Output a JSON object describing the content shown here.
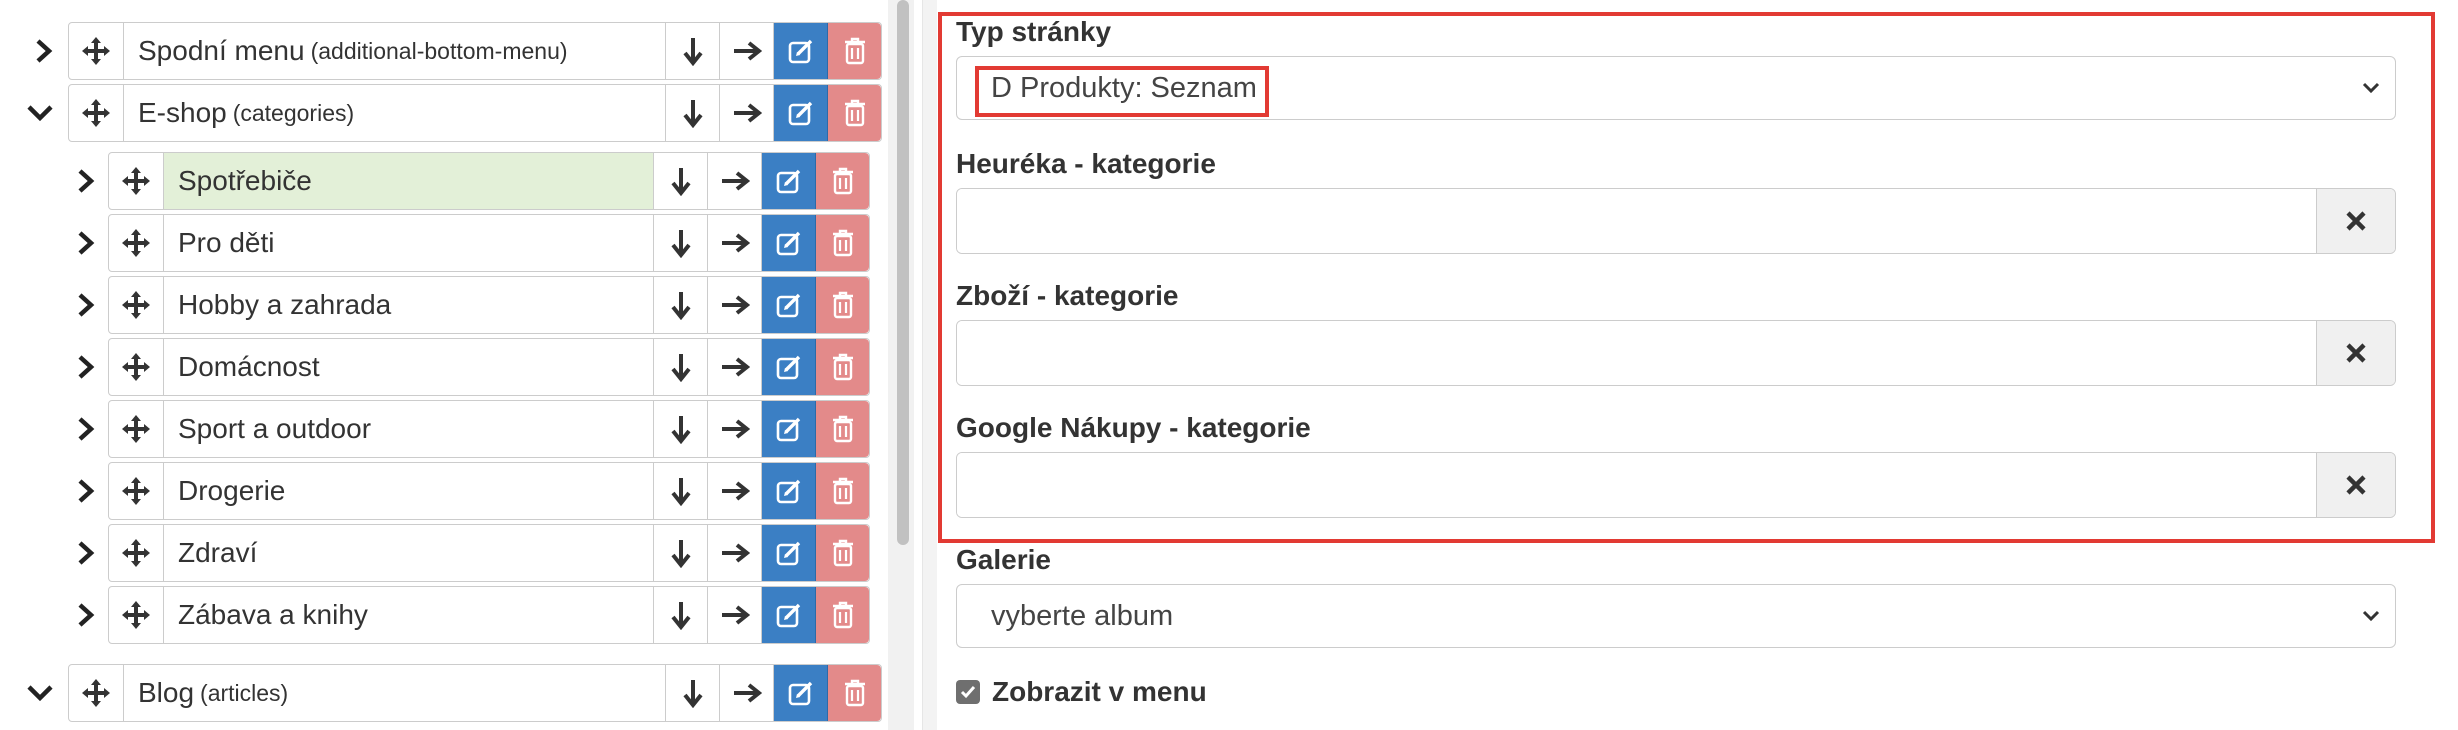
{
  "tree": {
    "top_items": [
      {
        "label": "Spodní menu",
        "slug": "(additional-bottom-menu)",
        "expanded": false
      },
      {
        "label": "E-shop",
        "slug": "(categories)",
        "expanded": true
      },
      {
        "label": "Blog",
        "slug": "(articles)",
        "expanded": true
      }
    ],
    "children": [
      {
        "label": "Spotřebiče",
        "selected": true
      },
      {
        "label": "Pro děti"
      },
      {
        "label": "Hobby a zahrada"
      },
      {
        "label": "Domácnost"
      },
      {
        "label": "Sport a outdoor"
      },
      {
        "label": "Drogerie"
      },
      {
        "label": "Zdraví"
      },
      {
        "label": "Zábava a knihy"
      }
    ]
  },
  "form": {
    "page_type": {
      "label": "Typ stránky",
      "value": "D Produkty: Seznam"
    },
    "heureka": {
      "label": "Heuréka - kategorie",
      "value": ""
    },
    "zbozi": {
      "label": "Zboží - kategorie",
      "value": ""
    },
    "google": {
      "label": "Google Nákupy - kategorie",
      "value": ""
    },
    "gallery": {
      "label": "Galerie",
      "value": "vyberte album"
    },
    "show_in_menu": {
      "label": "Zobrazit v menu",
      "checked": true
    }
  },
  "colors": {
    "edit_button": "#3b7fc4",
    "delete_button": "#e38a8a",
    "selected_row": "#e3f0d8",
    "highlight_frame": "#e23a33"
  },
  "icons": [
    "chevron-right-icon",
    "chevron-down-icon",
    "move-icon",
    "arrow-down-icon",
    "arrow-right-icon",
    "edit-icon",
    "trash-icon",
    "close-icon",
    "check-icon"
  ]
}
